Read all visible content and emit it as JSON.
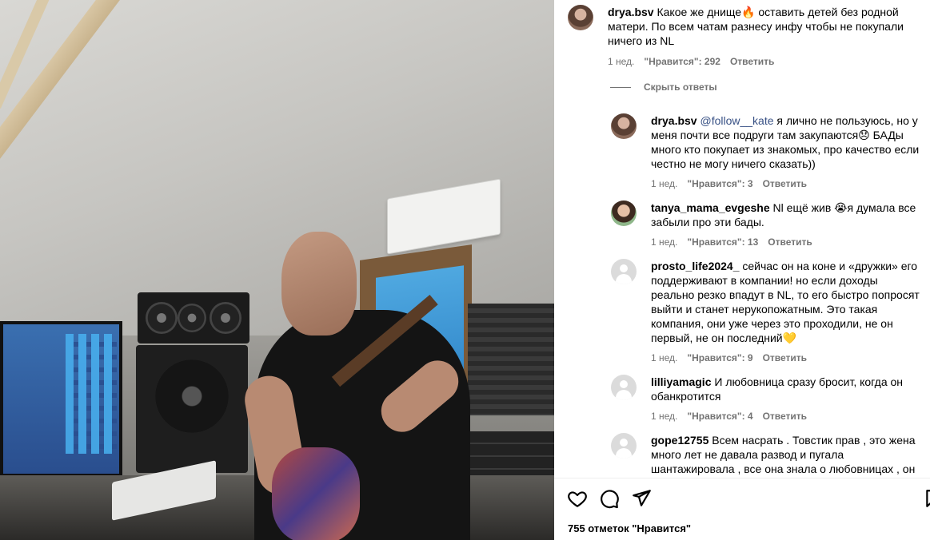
{
  "post": {
    "comments": [
      {
        "username": "drya.bsv",
        "text": "Какое же днище🔥 оставить детей без родной матери. По всем чатам разнесу инфу чтобы не покупали ничего из NL",
        "time": "1 нед.",
        "likes": "\"Нравится\": 292",
        "reply": "Ответить"
      }
    ],
    "hide_replies_label": "Скрыть ответы",
    "replies": [
      {
        "username": "drya.bsv",
        "mention": "@follow__kate",
        "text": " я лично не пользуюсь, но у меня почти все подруги там закупаются😞 БАДы много кто покупает из знакомых, про качество если честно не могу ничего сказать))",
        "time": "1 нед.",
        "likes": "\"Нравится\": 3",
        "reply": "Ответить"
      },
      {
        "username": "tanya_mama_evgeshe",
        "text": "Nl ещё жив 😭я думала все забыли про эти бады.",
        "time": "1 нед.",
        "likes": "\"Нравится\": 13",
        "reply": "Ответить"
      },
      {
        "username": "prosto_life2024_",
        "text": "сейчас он на коне и «дружки» его поддерживают в компании! но если доходы реально резко впадут в NL, то его быстро попросят выйти и станет нерукопожатным. Это такая компания, они уже через это проходили, не он первый, не он последний💛",
        "time": "1 нед.",
        "likes": "\"Нравится\": 9",
        "reply": "Ответить"
      },
      {
        "username": "lilliyamagic",
        "text": "И любовница сразу бросит, когда он обанкротится",
        "time": "1 нед.",
        "likes": "\"Нравится\": 4",
        "reply": "Ответить"
      },
      {
        "username": "gope12755",
        "text": "Всем насрать . Товстик прав , это жена много лет не давала развод и пугала шантажировала , все она знала о любовницах , он",
        "time": "",
        "likes": "",
        "reply": ""
      }
    ],
    "likes_total": "755 отметок \"Нравится\""
  },
  "icons": [
    "heart-icon",
    "comment-icon",
    "share-icon",
    "bookmark-icon"
  ],
  "colors": {
    "meta": "#737373",
    "mention": "#385185",
    "divider": "#efefef"
  }
}
